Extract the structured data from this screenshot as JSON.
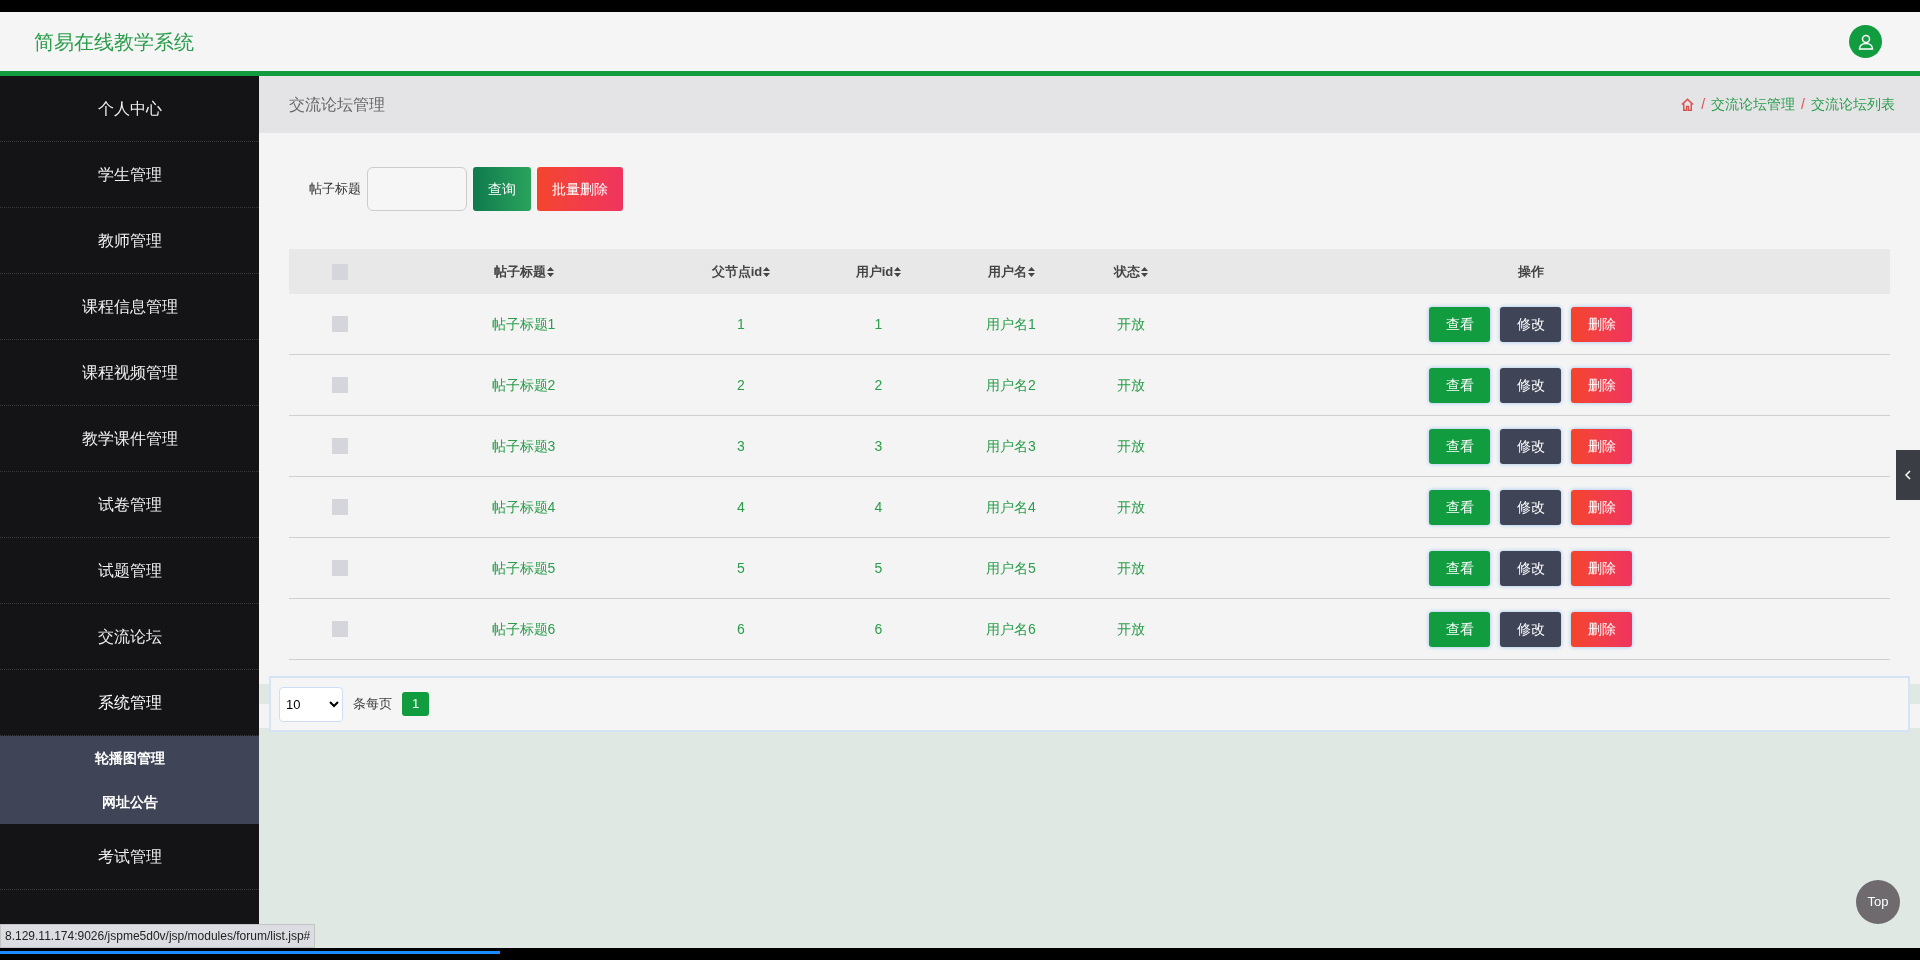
{
  "header": {
    "title": "简易在线教学系统"
  },
  "sidebar": {
    "items": [
      {
        "label": "个人中心",
        "expanded": false
      },
      {
        "label": "学生管理",
        "expanded": false
      },
      {
        "label": "教师管理",
        "expanded": false
      },
      {
        "label": "课程信息管理",
        "expanded": false
      },
      {
        "label": "课程视频管理",
        "expanded": false
      },
      {
        "label": "教学课件管理",
        "expanded": false
      },
      {
        "label": "试卷管理",
        "expanded": false
      },
      {
        "label": "试题管理",
        "expanded": false
      },
      {
        "label": "交流论坛",
        "expanded": false
      },
      {
        "label": "系统管理",
        "expanded": true,
        "children": [
          {
            "label": "轮播图管理"
          },
          {
            "label": "网址公告"
          }
        ]
      },
      {
        "label": "考试管理",
        "expanded": false
      }
    ]
  },
  "page_title": "交流论坛管理",
  "breadcrumb": [
    {
      "separator": "/",
      "label": "交流论坛管理"
    },
    {
      "separator": "/",
      "label": "交流论坛列表"
    }
  ],
  "search": {
    "label": "帖子标题",
    "buttons": [
      {
        "label": "查询",
        "kind": "search"
      },
      {
        "label": "批量删除",
        "kind": "danger"
      }
    ]
  },
  "table": {
    "header_checked": false,
    "columns": [
      {
        "label": "帖子标题",
        "sortable": true
      },
      {
        "label": "父节点id",
        "sortable": true
      },
      {
        "label": "用户id",
        "sortable": true
      },
      {
        "label": "用户名",
        "sortable": true
      },
      {
        "label": "状态",
        "sortable": true
      },
      {
        "label": "操作",
        "sortable": false
      }
    ],
    "rows": [
      {
        "checked": false,
        "cells": [
          "帖子标题1",
          "1",
          "1",
          "用户名1",
          "开放"
        ],
        "actions": [
          {
            "label": "查看",
            "kind": "view"
          },
          {
            "label": "修改",
            "kind": "edit"
          },
          {
            "label": "删除",
            "kind": "delete"
          }
        ]
      },
      {
        "checked": false,
        "cells": [
          "帖子标题2",
          "2",
          "2",
          "用户名2",
          "开放"
        ],
        "actions": [
          {
            "label": "查看",
            "kind": "view"
          },
          {
            "label": "修改",
            "kind": "edit"
          },
          {
            "label": "删除",
            "kind": "delete"
          }
        ]
      },
      {
        "checked": false,
        "cells": [
          "帖子标题3",
          "3",
          "3",
          "用户名3",
          "开放"
        ],
        "actions": [
          {
            "label": "查看",
            "kind": "view"
          },
          {
            "label": "修改",
            "kind": "edit"
          },
          {
            "label": "删除",
            "kind": "delete"
          }
        ]
      },
      {
        "checked": false,
        "cells": [
          "帖子标题4",
          "4",
          "4",
          "用户名4",
          "开放"
        ],
        "actions": [
          {
            "label": "查看",
            "kind": "view"
          },
          {
            "label": "修改",
            "kind": "edit"
          },
          {
            "label": "删除",
            "kind": "delete"
          }
        ]
      },
      {
        "checked": false,
        "cells": [
          "帖子标题5",
          "5",
          "5",
          "用户名5",
          "开放"
        ],
        "actions": [
          {
            "label": "查看",
            "kind": "view"
          },
          {
            "label": "修改",
            "kind": "edit"
          },
          {
            "label": "删除",
            "kind": "delete"
          }
        ]
      },
      {
        "checked": false,
        "cells": [
          "帖子标题6",
          "6",
          "6",
          "用户名6",
          "开放"
        ],
        "actions": [
          {
            "label": "查看",
            "kind": "view"
          },
          {
            "label": "修改",
            "kind": "edit"
          },
          {
            "label": "删除",
            "kind": "delete"
          }
        ]
      }
    ]
  },
  "pagination": {
    "page_size": "10",
    "per_page_label": "条每页",
    "pages": [
      {
        "label": "1",
        "selected": true
      }
    ]
  },
  "back_to_top": "Top",
  "status_url": "8.129.11.174:9026/jspme5d0v/jsp/modules/forum/list.jsp#"
}
